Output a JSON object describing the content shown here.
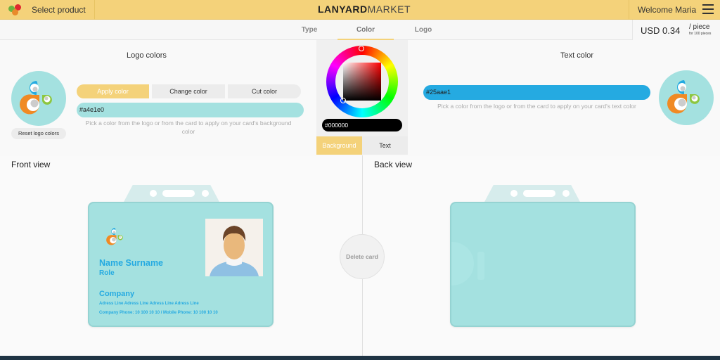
{
  "topbar": {
    "select_product": "Select product",
    "brand_bold": "LANYARD",
    "brand_light": "MARKET",
    "welcome": "Welcome Maria"
  },
  "tabs": [
    {
      "label": "Type",
      "active": false
    },
    {
      "label": "Color",
      "active": true
    },
    {
      "label": "Logo",
      "active": false
    }
  ],
  "price": {
    "amount": "USD 0.34",
    "unit": "/ piece",
    "note": "for 100 pieces"
  },
  "logo_colors": {
    "title": "Logo colors",
    "reset_label": "Reset logo colors",
    "buttons": [
      "Apply color",
      "Change color",
      "Cut color"
    ],
    "active_button": "Apply color",
    "hex_value": "#a4e1e0",
    "hint": "Pick a color from the logo or from the card to apply on your card's background color"
  },
  "picker": {
    "hex_value": "#000000",
    "toggle": [
      "Background",
      "Text"
    ],
    "active_toggle": "Background"
  },
  "text_color": {
    "title": "Text color",
    "hex_value": "#25aae1",
    "hint": "Pick a color from the logo or from the card to apply on your card's text color"
  },
  "front_view": {
    "title": "Front view",
    "name": "Name Surname",
    "role": "Role",
    "company": "Company",
    "address": "Adress Line Adress Line Adress Line Adress Line",
    "phones": "Company Phone: 10 100 10 10 / Mobile Phone: 10 100 10 10"
  },
  "back_view": {
    "title": "Back view"
  },
  "delete_label": "Delete card",
  "colors": {
    "accent": "#f4d27a",
    "card_bg": "#a4e1e0",
    "text": "#25aae1",
    "footer": "#1f3444"
  }
}
